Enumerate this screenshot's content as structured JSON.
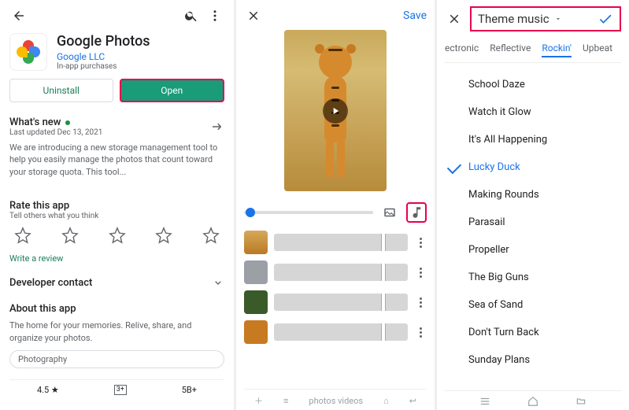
{
  "pane1": {
    "app_title": "Google Photos",
    "publisher": "Google LLC",
    "iap": "In-app purchases",
    "uninstall_label": "Uninstall",
    "open_label": "Open",
    "whats_new_label": "What's new",
    "last_updated": "Last updated Dec 13, 2021",
    "whats_new_desc": "We are introducing a new storage management tool to help you easily manage the photos that count toward your storage quota. This tool...",
    "rate_title": "Rate this app",
    "rate_sub": "Tell others what you think",
    "write_review": "Write a review",
    "developer_contact": "Developer contact",
    "about_title": "About this app",
    "about_desc": "The home for your memories. Relive, share, and organize your photos.",
    "category_chip": "Photography",
    "stats": {
      "rating": "4.5 ★",
      "age": "3+",
      "downloads": "5B+"
    }
  },
  "pane2": {
    "save_label": "Save",
    "bottom_text": "photos      videos"
  },
  "pane3": {
    "dropdown_label": "Theme music",
    "tabs": [
      "ectronic",
      "Reflective",
      "Rockin'",
      "Upbeat"
    ],
    "active_tab": 2,
    "songs": [
      "School Daze",
      "Watch it Glow",
      "It's All Happening",
      "Lucky Duck",
      "Making Rounds",
      "Parasail",
      "Propeller",
      "The Big Guns",
      "Sea of Sand",
      "Don't Turn Back",
      "Sunday Plans"
    ],
    "selected_song": 3
  }
}
